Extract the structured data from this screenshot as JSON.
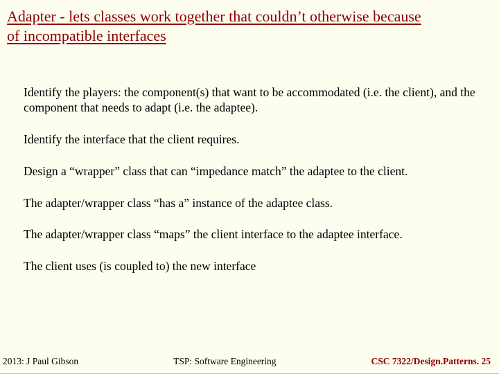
{
  "title": "Adapter - lets classes work together that couldn’t otherwise because of incompatible interfaces",
  "points": {
    "p0": "Identify the players: the component(s) that want to be accommodated (i.e. the client), and the component that needs to adapt (i.e. the adaptee).",
    "p1": "Identify the interface that the client requires.",
    "p2": "Design a “wrapper” class that can “impedance match” the adaptee to the client.",
    "p3": "The adapter/wrapper class “has a” instance of the adaptee class.",
    "p4": "The adapter/wrapper class “maps” the client interface to the adaptee interface.",
    "p5": "The client uses (is coupled to) the new interface"
  },
  "footer": {
    "left": "2013: J Paul Gibson",
    "center": "TSP: Software Engineering",
    "right": "CSC 7322/Design.Patterns. 25"
  }
}
